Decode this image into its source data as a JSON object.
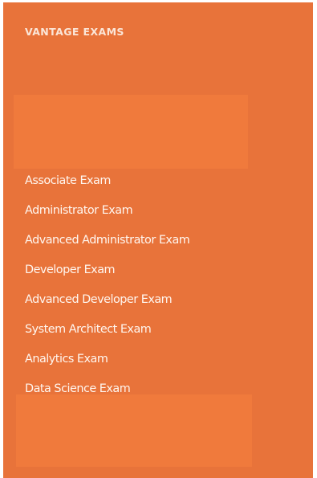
{
  "sidebar": {
    "title": "VANTAGE EXAMS",
    "items": [
      {
        "label": "Associate Exam"
      },
      {
        "label": "Administrator Exam"
      },
      {
        "label": "Advanced Administrator Exam"
      },
      {
        "label": "Developer Exam"
      },
      {
        "label": "Advanced Developer Exam"
      },
      {
        "label": "System Architect Exam"
      },
      {
        "label": "Analytics Exam"
      },
      {
        "label": "Data Science Exam"
      }
    ]
  },
  "colors": {
    "panel_background": "#e8733a",
    "highlight_block": "#f07a3c",
    "text": "#fff6ef"
  }
}
